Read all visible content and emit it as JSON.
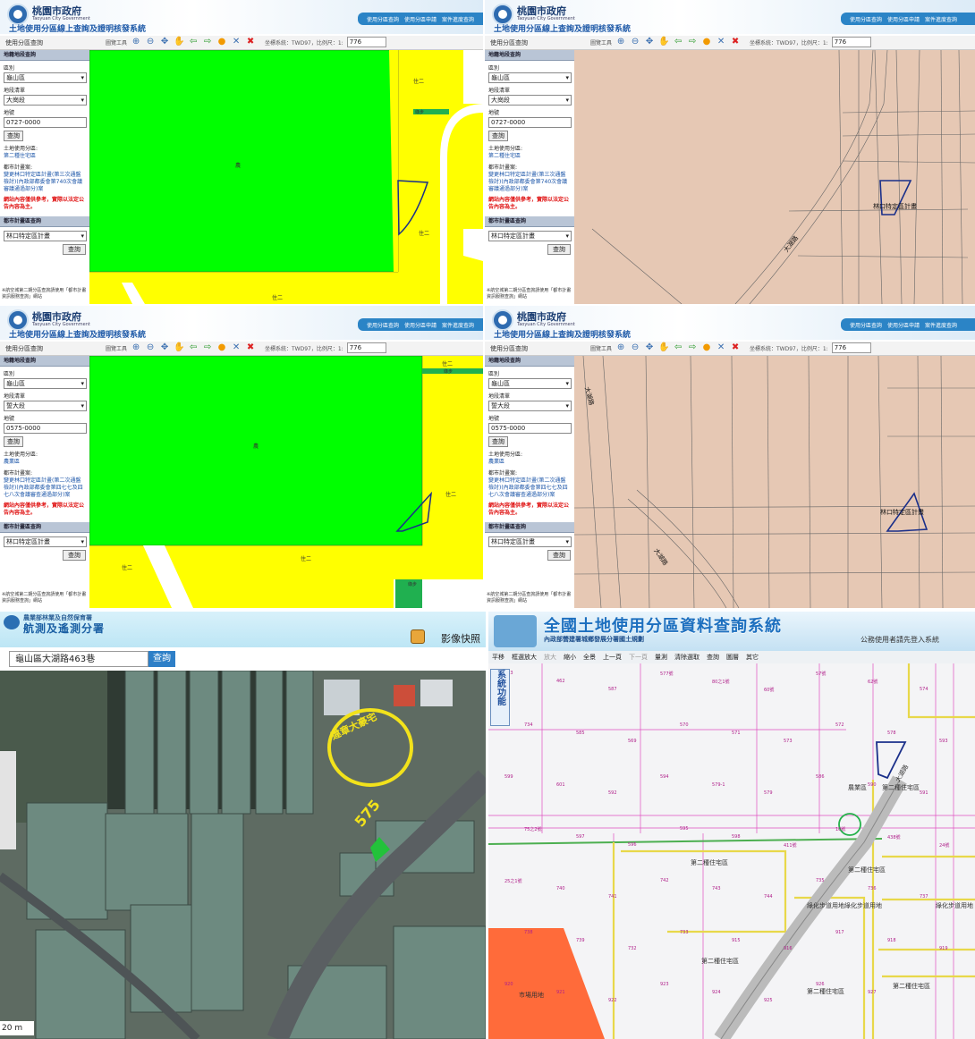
{
  "panel_a": {
    "gov_name": "桃園市政府",
    "gov_en": "Taoyuan City Government",
    "sys_title": "土地使用分區線上查詢及證明核發系統",
    "nav": [
      "使用分區查詢",
      "使用分區申請",
      "案件進度查詢"
    ],
    "tab_label": "使用分區查詢",
    "toolbar_label": "圖覽工具",
    "crs_text": "坐標系統：TWD97，比例尺：1:",
    "scale": "776",
    "sec_parcel": "地籍地段查詢",
    "district_label": "區別",
    "district": "龜山區",
    "section_label": "地段清單",
    "section": "大崗段",
    "parcel_label": "地號",
    "parcel": "0727-0000",
    "query": "查詢",
    "zone_label": "土地使用分區:",
    "zone": "第二種住宅區",
    "plan_label": "都市計畫案:",
    "plan": "變更林口特定區計畫(第三次通盤檢討)(內政部都委會第740次會議審議通過部分)案",
    "warning": "網站內容僅供參考，實際以法定公告內容為主。",
    "sec_plan": "都市計畫區查詢",
    "plan_area": "林口特定區計畫",
    "note": "※航空城第二期分區查詢請使用「都市計畫資訊服務查詢」網站",
    "map_labels": [
      "住二",
      "住二",
      "住二",
      "農",
      "綠步"
    ]
  },
  "panel_b": {
    "gov_name": "桃園市政府",
    "gov_en": "Taoyuan City Government",
    "sys_title": "土地使用分區線上查詢及證明核發系統",
    "nav": [
      "使用分區查詢",
      "使用分區申請",
      "案件進度查詢"
    ],
    "tab_label": "使用分區查詢",
    "toolbar_label": "圖覽工具",
    "crs_text": "坐標系統：TWD97，比例尺：1:",
    "scale": "776",
    "sec_parcel": "地籍地段查詢",
    "district_label": "區別",
    "district": "龜山區",
    "section_label": "地段清單",
    "section": "大崗段",
    "parcel_label": "地號",
    "parcel": "0727-0000",
    "query": "查詢",
    "zone_label": "土地使用分區:",
    "zone": "第二種住宅區",
    "plan_label": "都市計畫案:",
    "plan": "變更林口特定區計畫(第三次通盤檢討)(內政部都委會第740次會議審議通過部分)案",
    "warning": "網站內容僅供參考，實際以法定公告內容為主。",
    "sec_plan": "都市計畫區查詢",
    "plan_area": "林口特定區計畫",
    "note": "※航空城第二期分區查詢請使用「都市計畫資訊服務查詢」網站",
    "map_plan_label": "林口特定區計畫",
    "map_road_label": "大湖路"
  },
  "panel_c": {
    "gov_name": "桃園市政府",
    "gov_en": "Taoyuan City Government",
    "sys_title": "土地使用分區線上查詢及證明核發系統",
    "nav": [
      "使用分區查詢",
      "使用分區申請",
      "案件進度查詢"
    ],
    "tab_label": "使用分區查詢",
    "toolbar_label": "圖覽工具",
    "crs_text": "坐標系統：TWD97，比例尺：1:",
    "scale": "776",
    "sec_parcel": "地籍地段查詢",
    "district_label": "區別",
    "district": "龜山區",
    "section_label": "地段清單",
    "section": "誓大段",
    "parcel_label": "地號",
    "parcel": "0575-0000",
    "query": "查詢",
    "zone_label": "土地使用分區:",
    "zone": "農業區",
    "plan_label": "都市計畫案:",
    "plan": "變更林口特定區計畫(第二次通盤檢討)(內政部都委會第四七七及四七八次會議審查通過部分)案",
    "warning": "網站內容僅供參考，實際以法定公告內容為主。",
    "sec_plan": "都市計畫區查詢",
    "plan_area": "林口特定區計畫",
    "note": "※航空城第二期分區查詢請使用「都市計畫資訊服務查詢」網站",
    "map_labels": [
      "住二",
      "住二",
      "住二",
      "住二",
      "農",
      "綠步",
      "綠步"
    ]
  },
  "panel_d": {
    "gov_name": "桃園市政府",
    "gov_en": "Taoyuan City Government",
    "sys_title": "土地使用分區線上查詢及證明核發系統",
    "nav": [
      "使用分區查詢",
      "使用分區申請",
      "案件進度查詢"
    ],
    "tab_label": "使用分區查詢",
    "toolbar_label": "圖覽工具",
    "crs_text": "坐標系統：TWD97，比例尺：1:",
    "scale": "776",
    "sec_parcel": "地籍地段查詢",
    "district_label": "區別",
    "district": "龜山區",
    "section_label": "地段清單",
    "section": "誓大段",
    "parcel_label": "地號",
    "parcel": "0575-0000",
    "query": "查詢",
    "zone_label": "土地使用分區:",
    "zone": "農業區",
    "plan_label": "都市計畫案:",
    "plan": "變更林口特定區計畫(第二次通盤檢討)(內政部都委會第四七七及四七八次會議審查通過部分)案",
    "warning": "網站內容僅供參考，實際以法定公告內容為主。",
    "sec_plan": "都市計畫區查詢",
    "plan_area": "林口特定區計畫",
    "note": "※航空城第二期分區查詢請使用「都市計畫資訊服務查詢」網站",
    "map_plan_label": "林口特定區計畫",
    "map_road_labels": [
      "大湖路",
      "大湖路"
    ]
  },
  "panel_e": {
    "org": "農業部林業及自然保育署",
    "name": "航測及遙測分署",
    "snapshot": "影像快照",
    "search_value": "龜山區大湖路463巷",
    "search_button": "查詢",
    "annotation": "違章大豪宅",
    "parcel_number": "575",
    "scale_text": "20 m"
  },
  "panel_f": {
    "title": "全國土地使用分區資料查詢系統",
    "subtitle": "內政部營建署城鄉發展分署國土規劃",
    "public": "公務使用者請先登入系統",
    "toolbar": [
      "平移",
      "框選放大",
      "放大",
      "縮小",
      "全景",
      "上一頁",
      "下一頁",
      "量測",
      "清除選取",
      "查詢",
      "圖層",
      "其它"
    ],
    "side_label": "系統功能",
    "labels": [
      "第二種住宅區",
      "第二種住宅區",
      "第二種住宅區",
      "第二種住宅區",
      "第二種住宅區",
      "第二種住宅區",
      "農業區",
      "綠化步道用地綠化步道用地",
      "綠化步道用地",
      "市場用地",
      "大湖路"
    ],
    "parcels": [
      "463",
      "462",
      "587",
      "577號",
      "80之1號",
      "60號",
      "57號",
      "62號",
      "574",
      "734",
      "585",
      "569",
      "570",
      "571",
      "573",
      "572",
      "578",
      "593",
      "599",
      "601",
      "592",
      "594",
      "579-1",
      "579",
      "586",
      "590",
      "591",
      "75之2號",
      "597",
      "596",
      "595",
      "598",
      "411號",
      "10號",
      "438號",
      "24號",
      "25之1號",
      "740",
      "741",
      "742",
      "743",
      "744",
      "735",
      "736",
      "737",
      "738",
      "739",
      "732",
      "733",
      "915",
      "916",
      "917",
      "918",
      "919",
      "920",
      "921",
      "922",
      "923",
      "924",
      "925",
      "926",
      "927"
    ]
  }
}
